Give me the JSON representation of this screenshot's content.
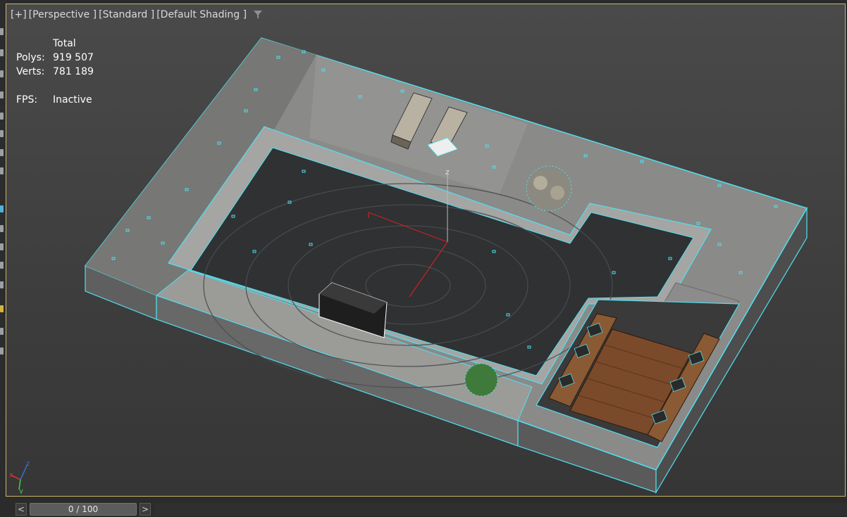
{
  "viewport": {
    "labels": [
      "[+]",
      "[Perspective ]",
      "[Standard ]",
      "[Default Shading ]"
    ],
    "filter_icon": "filter-icon",
    "frame_color": "#c8b868",
    "selection_color": "#4fe0f0"
  },
  "stats": {
    "header": "Total",
    "polys_label": "Polys:",
    "polys_value": "919 507",
    "verts_label": "Verts:",
    "verts_value": "781 189",
    "fps_label": "FPS:",
    "fps_value": "Inactive"
  },
  "gizmo": {
    "x_label": "x",
    "y_label": "y",
    "z_label": "z"
  },
  "scene_gizmo": {
    "z_label": "z"
  },
  "timeline": {
    "prev_label": "<",
    "slider_label": "0 / 100",
    "next_label": ">"
  }
}
